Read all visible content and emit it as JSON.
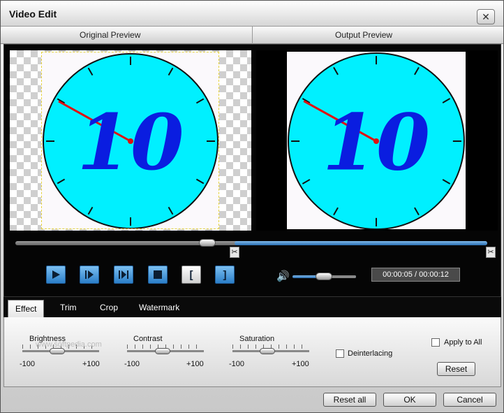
{
  "window": {
    "title": "Video Edit",
    "close_glyph": "✕"
  },
  "preview": {
    "original_label": "Original Preview",
    "output_label": "Output Preview"
  },
  "clock": {
    "number": "10"
  },
  "player": {
    "time": "00:00:05 / 00:00:12",
    "progress": 0.41,
    "volume": 0.5
  },
  "tabs": [
    {
      "label": "Effect",
      "active": true
    },
    {
      "label": "Trim"
    },
    {
      "label": "Crop"
    },
    {
      "label": "Watermark"
    }
  ],
  "effect": {
    "brightness": {
      "label": "Brightness",
      "min": "-100",
      "max": "+100",
      "value": 0
    },
    "contrast": {
      "label": "Contrast",
      "min": "-100",
      "max": "+100",
      "value": 0
    },
    "saturation": {
      "label": "Saturation",
      "min": "-100",
      "max": "+100",
      "value": 0
    },
    "deinterlacing_label": "Deinterlacing",
    "apply_to_all_label": "Apply to All",
    "reset_label": "Reset"
  },
  "footer": {
    "reset_all_label": "Reset all",
    "ok_label": "OK",
    "cancel_label": "Cancel"
  },
  "watermark_text": "www.softpedia.com",
  "colors": {
    "clock_face": "#00f0ff",
    "digits": "#0a1de0",
    "hand": "#e01010",
    "selection": "#2a6fb2"
  },
  "icons": [
    "close-icon",
    "play-icon",
    "step-forward-icon",
    "next-frame-icon",
    "stop-icon",
    "mark-in-icon",
    "mark-out-icon",
    "volume-icon",
    "scissors-icon"
  ]
}
